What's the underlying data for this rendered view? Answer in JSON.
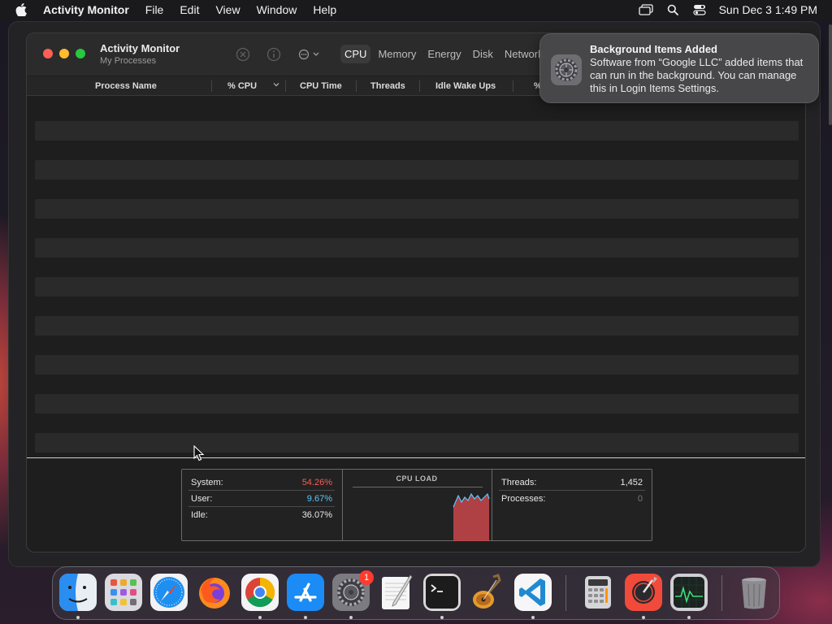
{
  "menubar": {
    "app_name": "Activity Monitor",
    "items": [
      "File",
      "Edit",
      "View",
      "Window",
      "Help"
    ],
    "clock": "Sun Dec 3  1:49 PM"
  },
  "window": {
    "title": "Activity Monitor",
    "subtitle": "My Processes",
    "tabs": [
      {
        "label": "CPU",
        "active": true
      },
      {
        "label": "Memory",
        "active": false
      },
      {
        "label": "Energy",
        "active": false
      },
      {
        "label": "Disk",
        "active": false
      },
      {
        "label": "Network",
        "active": false
      }
    ],
    "columns": [
      "Process Name",
      "% CPU",
      "CPU Time",
      "Threads",
      "Idle Wake Ups",
      "%"
    ]
  },
  "stats": {
    "system_label": "System:",
    "system_value": "54.26%",
    "user_label": "User:",
    "user_value": "9.67%",
    "idle_label": "Idle:",
    "idle_value": "36.07%",
    "cpu_load_title": "CPU LOAD",
    "threads_label": "Threads:",
    "threads_value": "1,452",
    "processes_label": "Processes:",
    "processes_value": "0",
    "colors": {
      "system": "#ff5a55",
      "user": "#5ac8fa"
    }
  },
  "notification": {
    "title": "Background Items Added",
    "body": "Software from “Google LLC” added items that can run in the background. You can manage this in Login Items Settings."
  },
  "dock": {
    "apps": [
      "finder-icon",
      "launchpad-icon",
      "safari-icon",
      "firefox-icon",
      "chrome-icon",
      "app-store-icon",
      "system-settings-icon",
      "textedit-icon",
      "terminal-icon",
      "garageband-icon",
      "vscode-icon",
      "calculator-icon",
      "instruments-icon",
      "activity-monitor-icon",
      "trash-icon"
    ],
    "settings_badge": "1"
  }
}
